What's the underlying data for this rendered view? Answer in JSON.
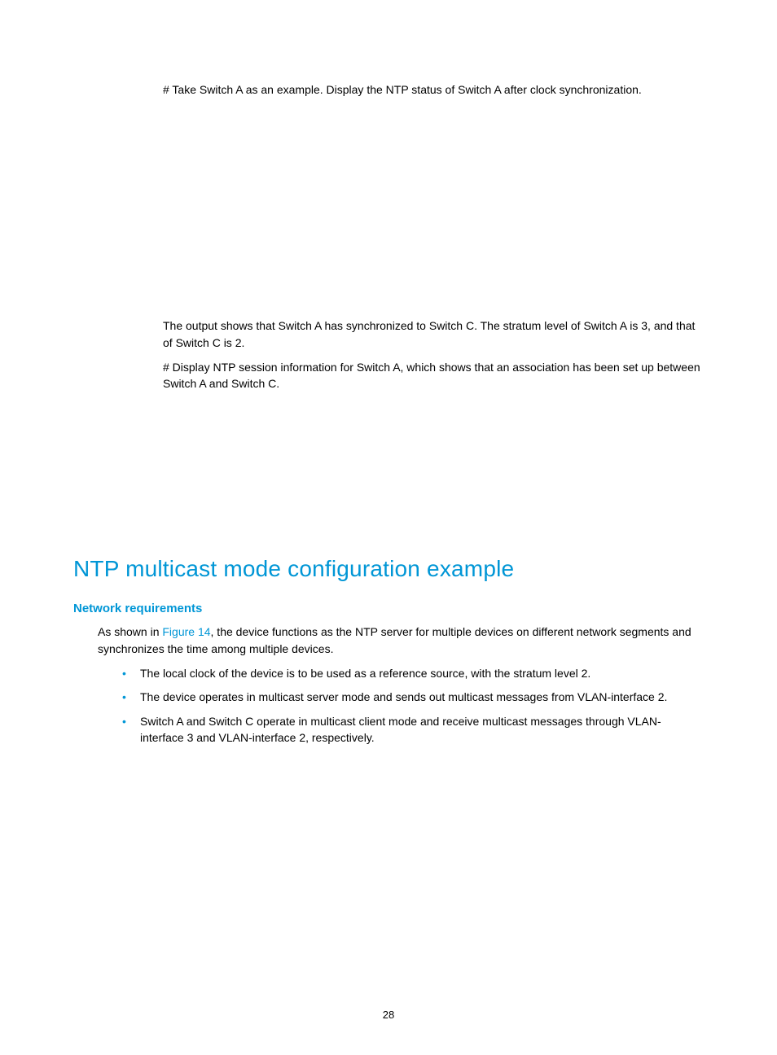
{
  "content": {
    "para1": "# Take Switch A as an example. Display the NTP status of Switch A after clock synchronization.",
    "para2": "The output shows that Switch A has synchronized to Switch C. The stratum level of Switch A is 3, and that of Switch C is 2.",
    "para3": "# Display NTP session information for Switch A, which shows that an association has been set up between Switch A and Switch C."
  },
  "section": {
    "title": "NTP multicast mode configuration example",
    "subhead": "Network requirements",
    "intro_pre": "As shown in ",
    "intro_link": "Figure 14",
    "intro_post": ", the device functions as the NTP server for multiple devices on different network segments and synchronizes the time among multiple devices.",
    "bullets": [
      "The local clock of the device is to be used as a reference source, with the stratum level 2.",
      "The device operates in multicast server mode and sends out multicast messages from VLAN-interface 2.",
      "Switch A and Switch C operate in multicast client mode and receive multicast messages through VLAN-interface 3 and VLAN-interface 2, respectively."
    ]
  },
  "page_number": "28"
}
